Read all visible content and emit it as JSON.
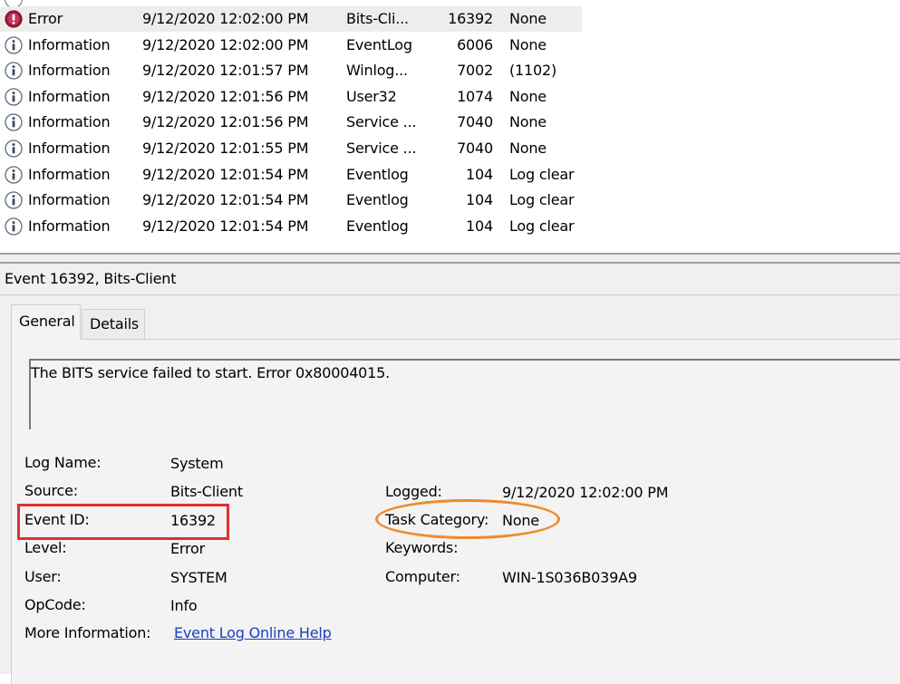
{
  "event_list": {
    "rows": [
      {
        "level": "Error",
        "date": "9/12/2020 12:02:00 PM",
        "source": "Bits-Cli...",
        "event_id": "16392",
        "task_category": "None",
        "icon": "error-icon",
        "selected": true
      },
      {
        "level": "Information",
        "date": "9/12/2020 12:02:00 PM",
        "source": "EventLog",
        "event_id": "6006",
        "task_category": "None",
        "icon": "information-icon"
      },
      {
        "level": "Information",
        "date": "9/12/2020 12:01:57 PM",
        "source": "Winlog...",
        "event_id": "7002",
        "task_category": "(1102)",
        "icon": "information-icon"
      },
      {
        "level": "Information",
        "date": "9/12/2020 12:01:56 PM",
        "source": "User32",
        "event_id": "1074",
        "task_category": "None",
        "icon": "information-icon"
      },
      {
        "level": "Information",
        "date": "9/12/2020 12:01:56 PM",
        "source": "Service ...",
        "event_id": "7040",
        "task_category": "None",
        "icon": "information-icon"
      },
      {
        "level": "Information",
        "date": "9/12/2020 12:01:55 PM",
        "source": "Service ...",
        "event_id": "7040",
        "task_category": "None",
        "icon": "information-icon"
      },
      {
        "level": "Information",
        "date": "9/12/2020 12:01:54 PM",
        "source": "Eventlog",
        "event_id": "104",
        "task_category": "Log clear",
        "icon": "information-icon"
      },
      {
        "level": "Information",
        "date": "9/12/2020 12:01:54 PM",
        "source": "Eventlog",
        "event_id": "104",
        "task_category": "Log clear",
        "icon": "information-icon"
      },
      {
        "level": "Information",
        "date": "9/12/2020 12:01:54 PM",
        "source": "Eventlog",
        "event_id": "104",
        "task_category": "Log clear",
        "icon": "information-icon"
      }
    ]
  },
  "details": {
    "title": "Event 16392, Bits-Client",
    "tabs": {
      "general": "General",
      "details": "Details"
    },
    "description": "The BITS service failed to start.  Error 0x80004015.",
    "fields": {
      "log_name": {
        "label": "Log Name:",
        "value": "System"
      },
      "source": {
        "label": "Source:",
        "value": "Bits-Client"
      },
      "event_id": {
        "label": "Event ID:",
        "value": "16392"
      },
      "level": {
        "label": "Level:",
        "value": "Error"
      },
      "user": {
        "label": "User:",
        "value": "SYSTEM"
      },
      "opcode": {
        "label": "OpCode:",
        "value": "Info"
      },
      "more_information": {
        "label": "More Information:",
        "value": "Event Log Online Help"
      },
      "logged": {
        "label": "Logged:",
        "value": "9/12/2020 12:02:00 PM"
      },
      "task_category": {
        "label": "Task Category:",
        "value": "None"
      },
      "keywords": {
        "label": "Keywords:",
        "value": ""
      },
      "computer": {
        "label": "Computer:",
        "value": "WIN-1S036B039A9"
      }
    }
  },
  "colors": {
    "event_id_highlight": "#e03030",
    "task_category_highlight": "#f08a2a",
    "link": "#1a3fbf",
    "error_icon": "#a3173a"
  }
}
